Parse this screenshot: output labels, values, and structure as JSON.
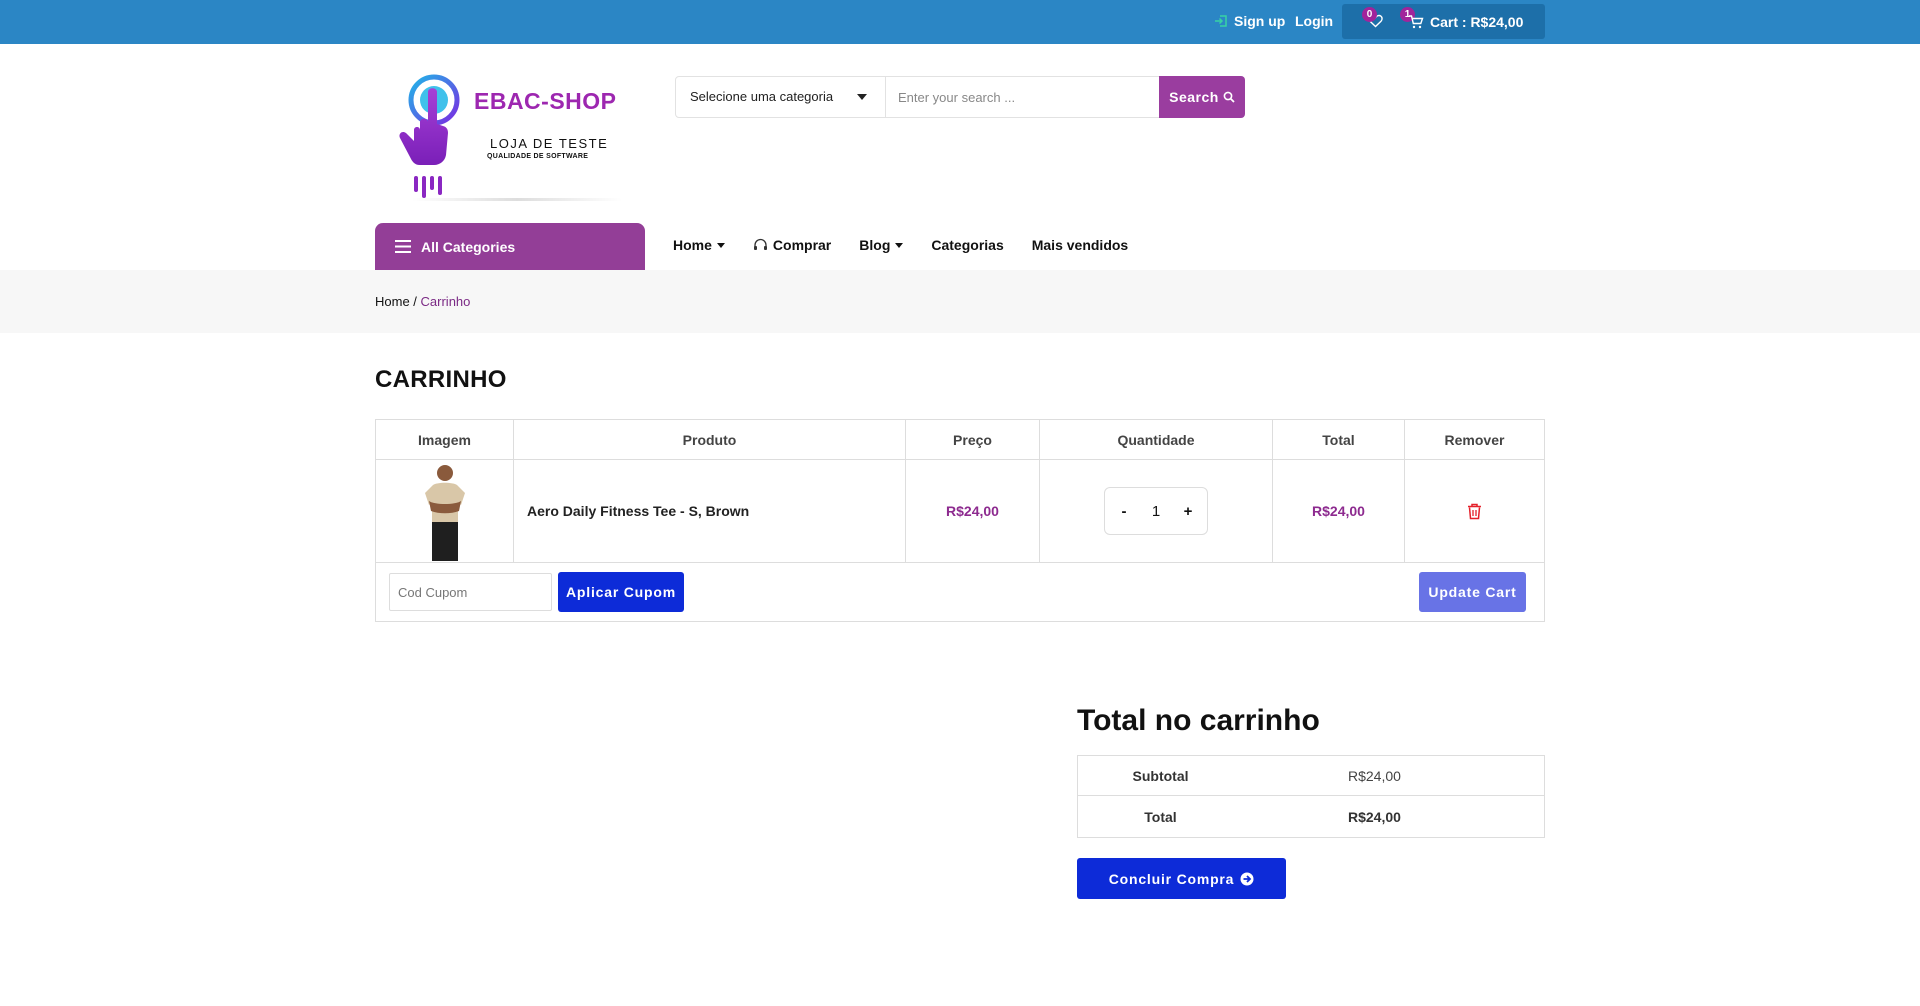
{
  "topbar": {
    "signup_label": "Sign up",
    "login_label": "Login",
    "wishlist_count": "0",
    "cart_count": "1",
    "cart_label": "Cart : R$24,00",
    "bg_color": "#2b86c5"
  },
  "logo": {
    "title": "EBAC-SHOP",
    "subtitle": "LOJA DE TESTE",
    "tagline": "QUALIDADE DE SOFTWARE"
  },
  "search": {
    "category_label": "Selecione uma categoria",
    "placeholder": "Enter your search ...",
    "button_label": "Search"
  },
  "nav": {
    "all_categories": "All Categories",
    "items": [
      {
        "label": "Home",
        "dropdown": true
      },
      {
        "label": "Comprar",
        "icon": "headset-icon"
      },
      {
        "label": "Blog",
        "dropdown": true
      },
      {
        "label": "Categorias"
      },
      {
        "label": "Mais vendidos"
      }
    ]
  },
  "breadcrumb": {
    "home": "Home",
    "separator": " / ",
    "current": "Carrinho"
  },
  "cart": {
    "title": "CARRINHO",
    "headers": [
      "Imagem",
      "Produto",
      "Preço",
      "Quantidade",
      "Total",
      "Remover"
    ],
    "items": [
      {
        "product": "Aero Daily Fitness Tee - S, Brown",
        "price": "R$24,00",
        "quantity": "1",
        "total": "R$24,00",
        "image": "brown-tee-model"
      }
    ],
    "qty_minus": "-",
    "qty_plus": "+",
    "coupon_placeholder": "Cod Cupom",
    "apply_coupon": "Aplicar Cupom",
    "update_cart": "Update Cart"
  },
  "totals": {
    "title": "Total no carrinho",
    "subtotal_label": "Subtotal",
    "subtotal_value": "R$24,00",
    "total_label": "Total",
    "total_value": "R$24,00",
    "checkout_label": "Concluir Compra"
  },
  "colors": {
    "accent_purple": "#933e97",
    "primary_blue": "#0d2bd8",
    "update_blue": "#6873e6",
    "price_purple": "#8d2a8f"
  }
}
